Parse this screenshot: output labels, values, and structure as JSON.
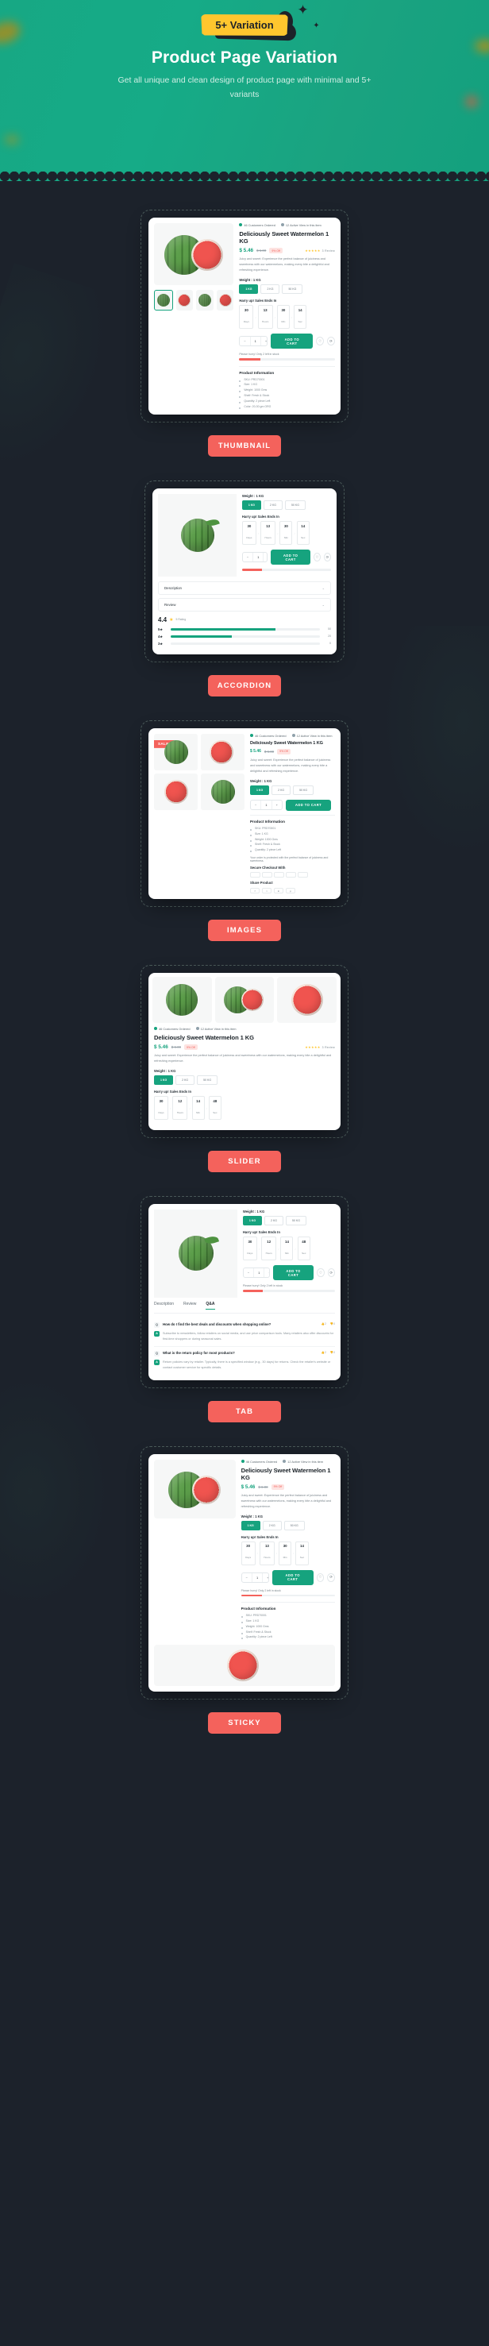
{
  "hero": {
    "badge": "5+ Variation",
    "title": "Product Page Variation",
    "subtitle": "Get all unique and clean design of product page with minimal and  5+ variants"
  },
  "product": {
    "sale_badge": "SALE",
    "meta_ordered": "46 Customers Ordered",
    "meta_active": "12 Active View in this item",
    "title": "Deliciously Sweet Watermelon 1 KG",
    "price": "$ 5.46",
    "old_price": "$ 6.00",
    "discount": "9% Off",
    "stars": "★★★★★",
    "review_count": "3 Review",
    "description": "Juicy and sweet: Experience the perfect balance of juiciness and sweetness with our watermelons, making every bite a delightful and refreshing experience.",
    "weight_label": "Weight : 1 KG",
    "weight_options": [
      "1 KG",
      "2 KG",
      "50 KG"
    ],
    "weight_selected": "1 KG",
    "sale_ends_label": "Harry up! Sales Ends In",
    "countdown": [
      {
        "value": "30",
        "unit": "Days"
      },
      {
        "value": "13",
        "unit": "Hours"
      },
      {
        "value": "30",
        "unit": "Min"
      },
      {
        "value": "14",
        "unit": "Sec"
      }
    ],
    "countdown_alt": [
      {
        "value": "30",
        "unit": "Days"
      },
      {
        "value": "12",
        "unit": "Hours"
      },
      {
        "value": "14",
        "unit": "Min"
      },
      {
        "value": "48",
        "unit": "Sec"
      }
    ],
    "qty_minus": "−",
    "qty_value": "1",
    "qty_plus": "+",
    "add_to_cart": "ADD TO CART",
    "stock_text": "Please hurry! Only 2 left in stock",
    "info_heading": "Product Information",
    "info_items": [
      "SKU: PRD70001",
      "Size: 1 KG",
      "Weight: 1000 Gms",
      "Shelf: Fresh & Stock",
      "Quantity: 2 piece Left",
      "Color: 20-30 gm ORG"
    ],
    "share_label": "Share Product",
    "socials": [
      "f",
      "t",
      "in",
      "p"
    ],
    "payment_label": "Secure Checkout With",
    "payments": [
      "VISA",
      "AMEX",
      "PayPal",
      "Stripe",
      "GPay"
    ],
    "guarantee": "Your order is protected with the perfect balance of juiciness and sweetness."
  },
  "accordion": {
    "items": [
      {
        "label": "Description",
        "open": false
      },
      {
        "label": "Review",
        "open": true
      }
    ],
    "rating_value": "4.4",
    "rating_star": "★",
    "rating_count": "5 Rating",
    "bars": [
      {
        "label": "5",
        "value": "50",
        "pct": 70
      },
      {
        "label": "4",
        "value": "20",
        "pct": 41
      },
      {
        "label": "3",
        "value": "0",
        "pct": 0
      }
    ]
  },
  "tabs": {
    "items": [
      "Description",
      "Review",
      "Q&A"
    ],
    "active": "Q&A",
    "qa": [
      {
        "q_mark": "Q",
        "a_mark": "A",
        "question": "How do I find the best deals and discounts when shopping online?",
        "answer": "Subscribe to newsletters, follow retailers on social media, and use price comparison tools. Many retailers also offer discounts for first-time shoppers or during seasonal sales.",
        "up": "2",
        "down": "0"
      },
      {
        "q_mark": "Q",
        "a_mark": "A",
        "question": "What is the return policy for most products?",
        "answer": "Return policies vary by retailer. Typically, there is a specified window (e.g., 30 days) for returns. Check the retailer's website or contact customer service for specific details.",
        "up": "2",
        "down": "0"
      }
    ]
  },
  "sections": [
    {
      "id": "thumbnail",
      "label": "THUMBNAIL"
    },
    {
      "id": "accordion",
      "label": "ACCORDION"
    },
    {
      "id": "images",
      "label": "IMAGES"
    },
    {
      "id": "slider",
      "label": "SLIDER"
    },
    {
      "id": "tab",
      "label": "TAB"
    },
    {
      "id": "sticky",
      "label": "STICKY"
    }
  ],
  "colors": {
    "brand_green": "#16a37e",
    "hero_green": "#17a884",
    "accent_red": "#f4625c",
    "badge_yellow": "#ffc62e",
    "dark_bg": "#1c222b"
  }
}
